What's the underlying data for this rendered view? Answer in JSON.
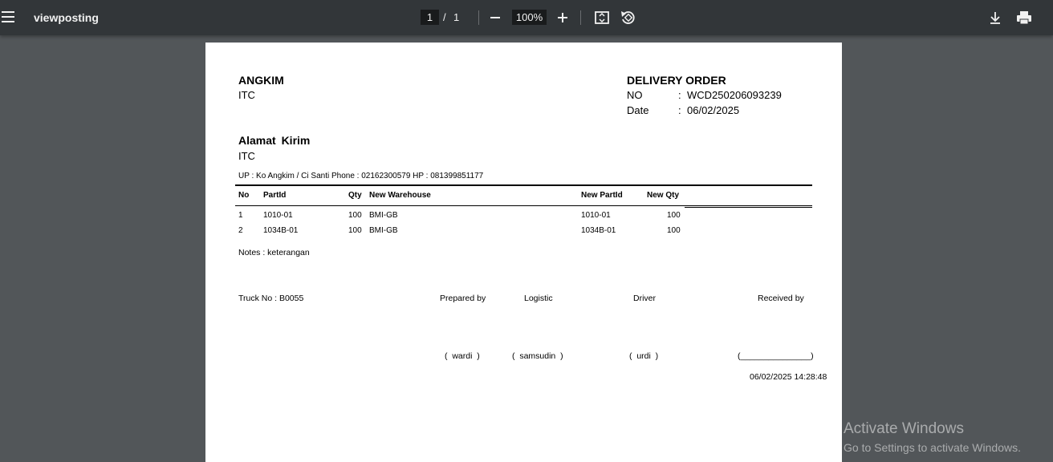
{
  "toolbar": {
    "title": "viewposting",
    "current_page": "1",
    "separator": "/",
    "total_pages": "1",
    "zoom": "100%"
  },
  "doc": {
    "company": "ANGKIM",
    "company_sub": "ITC",
    "title": "DELIVERY ORDER",
    "no_label": "NO",
    "colon": ":",
    "no_value": "WCD250206093239",
    "date_label": "Date",
    "date_value": "06/02/2025",
    "alamat_title": "Alamat  Kirim",
    "alamat_sub": "ITC",
    "contact": "UP : Ko Angkim / Ci Santi   Phone : 02162300579   HP : 081399851177",
    "table": {
      "headers": [
        "No",
        "PartId",
        "Qty",
        "New Warehouse",
        "New PartId",
        "New Qty"
      ],
      "rows": [
        [
          "1",
          "1010-01",
          "100",
          "BMI-GB",
          "1010-01",
          "100"
        ],
        [
          "2",
          "1034B-01",
          "100",
          "BMI-GB",
          "1034B-01",
          "100"
        ]
      ]
    },
    "notes": "Notes : keterangan",
    "truck": "Truck No : B0055",
    "signatures": {
      "labels": [
        "Prepared by",
        "Logistic",
        "Driver",
        "Received by"
      ],
      "names": [
        "(  wardi  )",
        "(  samsudin  )",
        "(  urdi  )",
        "(_______________)"
      ]
    },
    "printed_at": "06/02/2025 14:28:48"
  },
  "watermark": {
    "line1": "Activate Windows",
    "line2": "Go to Settings to activate Windows."
  }
}
